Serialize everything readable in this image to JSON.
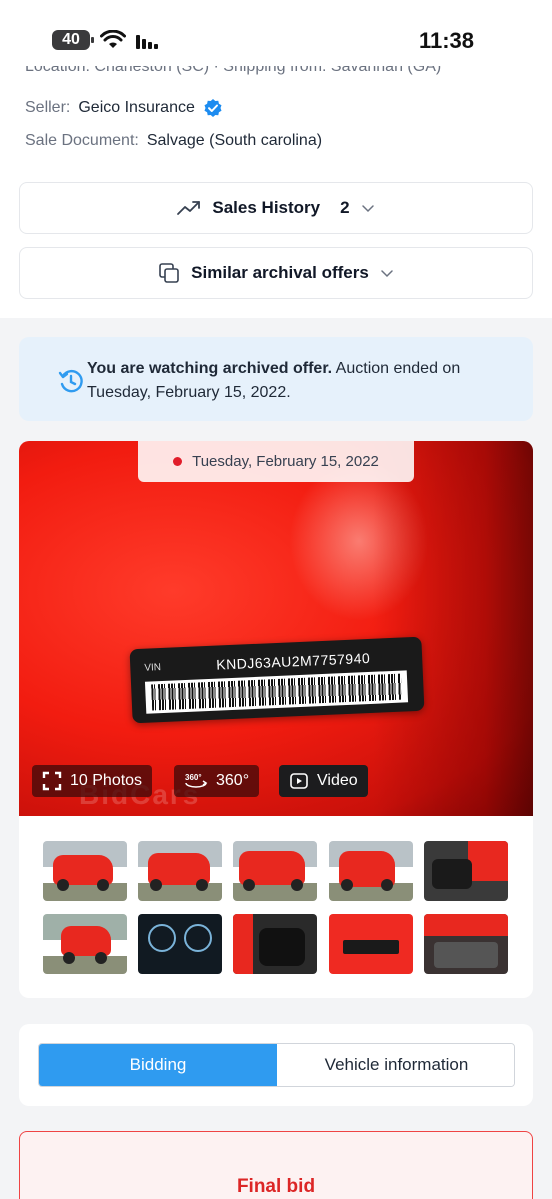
{
  "status_bar": {
    "time": "11:38",
    "battery": "40"
  },
  "details": {
    "partial_row": "Location: Charleston (SC) · Shipping from: Savannah (GA)",
    "seller_label": "Seller:",
    "seller_value": "Geico Insurance",
    "doc_label": "Sale Document:",
    "doc_value": "Salvage (South carolina)"
  },
  "sales_history": {
    "label": "Sales History",
    "count": "2"
  },
  "similar_offers": {
    "label": "Similar archival offers"
  },
  "notice": {
    "bold": "You are watching archived offer.",
    "text": " Auction ended on Tuesday, February 15, 2022."
  },
  "gallery": {
    "date": "Tuesday, February 15, 2022",
    "vin_prefix": "VIN",
    "vin": "KNDJ63AU2M7757940",
    "watermark": "BidCars",
    "photos_label": "10 Photos",
    "view360_label": "360°",
    "video_label": "Video"
  },
  "tabs": {
    "bidding": "Bidding",
    "vehicle_info": "Vehicle information"
  },
  "final_bid": {
    "label": "Final bid"
  },
  "colors": {
    "accent": "#2f9bf0",
    "notice_bg": "#e6f1fb",
    "danger": "#dc2626"
  }
}
